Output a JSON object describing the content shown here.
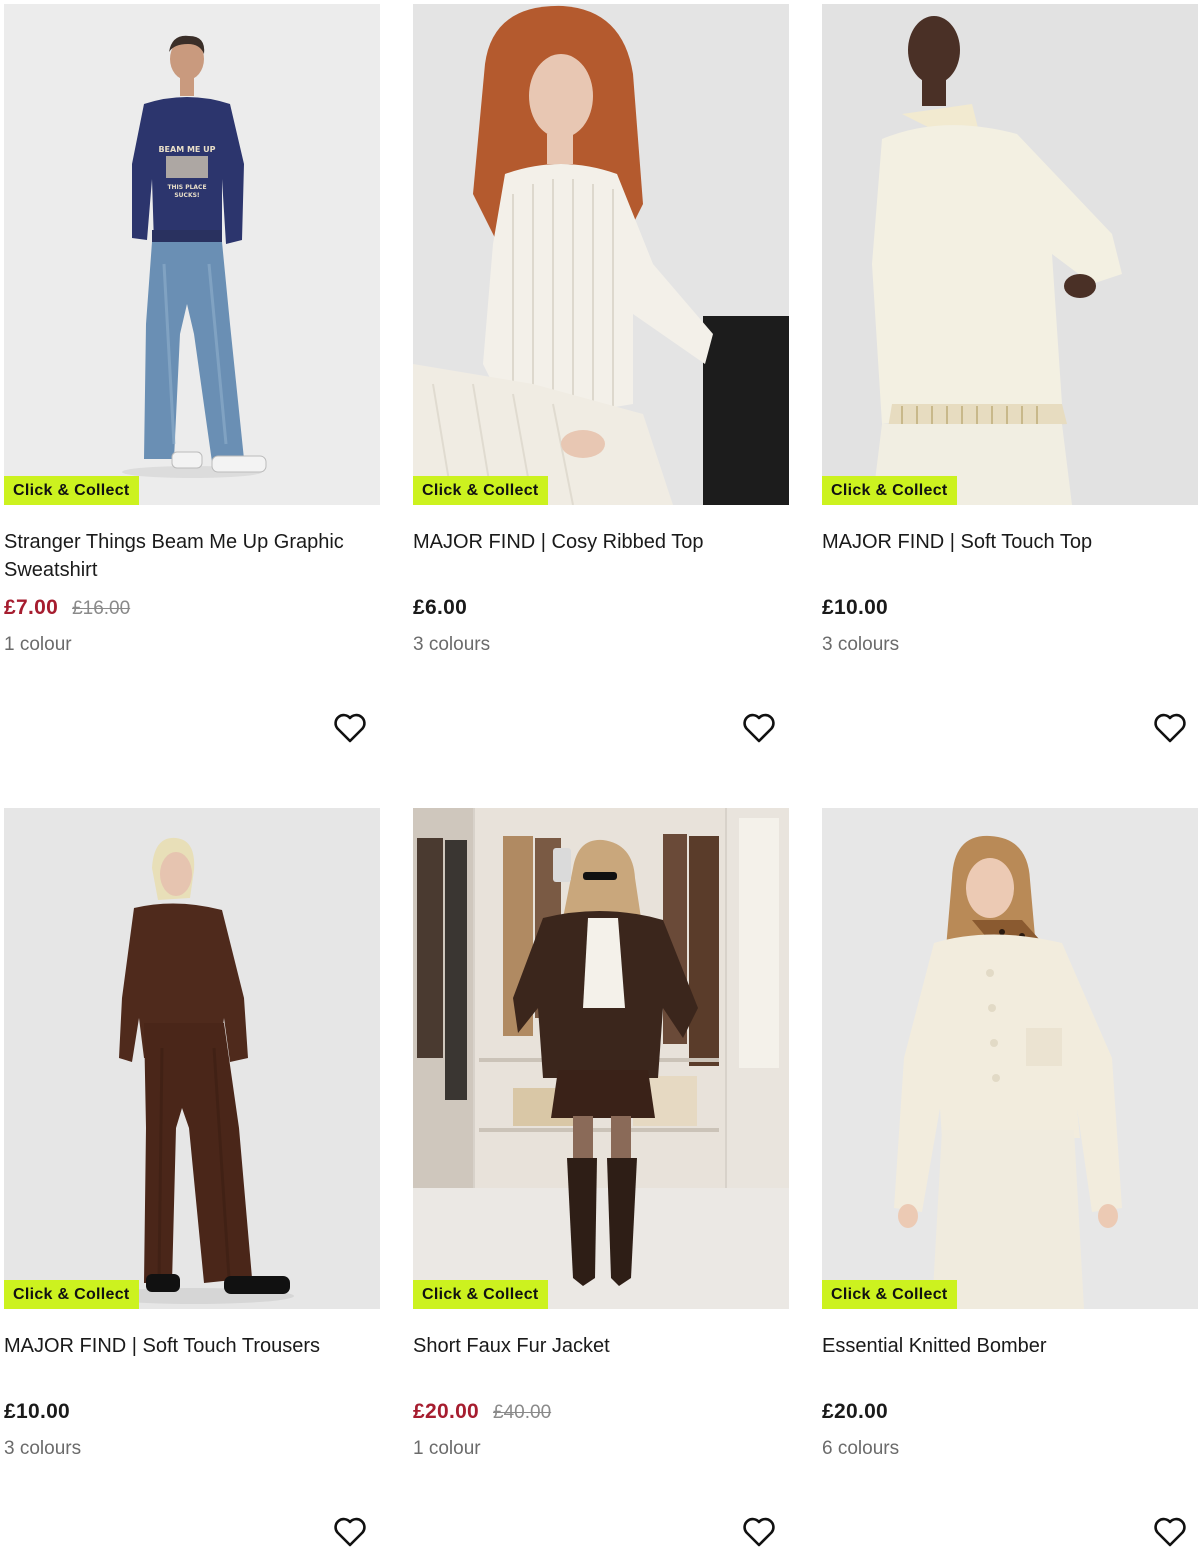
{
  "products": [
    {
      "badge": "Click & Collect",
      "title": "Stranger Things Beam Me Up Graphic Sweatshirt",
      "price": "£7.00",
      "was_price": "£16.00",
      "on_sale": true,
      "colours": "1 colour",
      "image_text": [
        "BEAM ME UP",
        "THIS PLACE",
        "SUCKS!"
      ],
      "wishlist_icon": "heart-outline-icon"
    },
    {
      "badge": "Click & Collect",
      "title": "MAJOR FIND | Cosy Ribbed Top",
      "price": "£6.00",
      "was_price": "",
      "on_sale": false,
      "colours": "3 colours",
      "wishlist_icon": "heart-outline-icon"
    },
    {
      "badge": "Click & Collect",
      "title": "MAJOR FIND | Soft Touch Top",
      "price": "£10.00",
      "was_price": "",
      "on_sale": false,
      "colours": "3 colours",
      "wishlist_icon": "heart-outline-icon"
    },
    {
      "badge": "Click & Collect",
      "title": "MAJOR FIND | Soft Touch Trousers",
      "price": "£10.00",
      "was_price": "",
      "on_sale": false,
      "colours": "3 colours",
      "wishlist_icon": "heart-outline-icon"
    },
    {
      "badge": "Click & Collect",
      "title": "Short Faux Fur Jacket",
      "price": "£20.00",
      "was_price": "£40.00",
      "on_sale": true,
      "colours": "1 colour",
      "wishlist_icon": "heart-outline-icon"
    },
    {
      "badge": "Click & Collect",
      "title": "Essential Knitted Bomber",
      "price": "£20.00",
      "was_price": "",
      "on_sale": false,
      "colours": "6 colours",
      "wishlist_icon": "heart-outline-icon"
    }
  ],
  "colors": {
    "badge_bg": "#ccf21f",
    "sale_price": "#a61d2f",
    "was_price": "#8a8a8a",
    "text": "#1a1a1a",
    "muted": "#6b6b6b"
  }
}
